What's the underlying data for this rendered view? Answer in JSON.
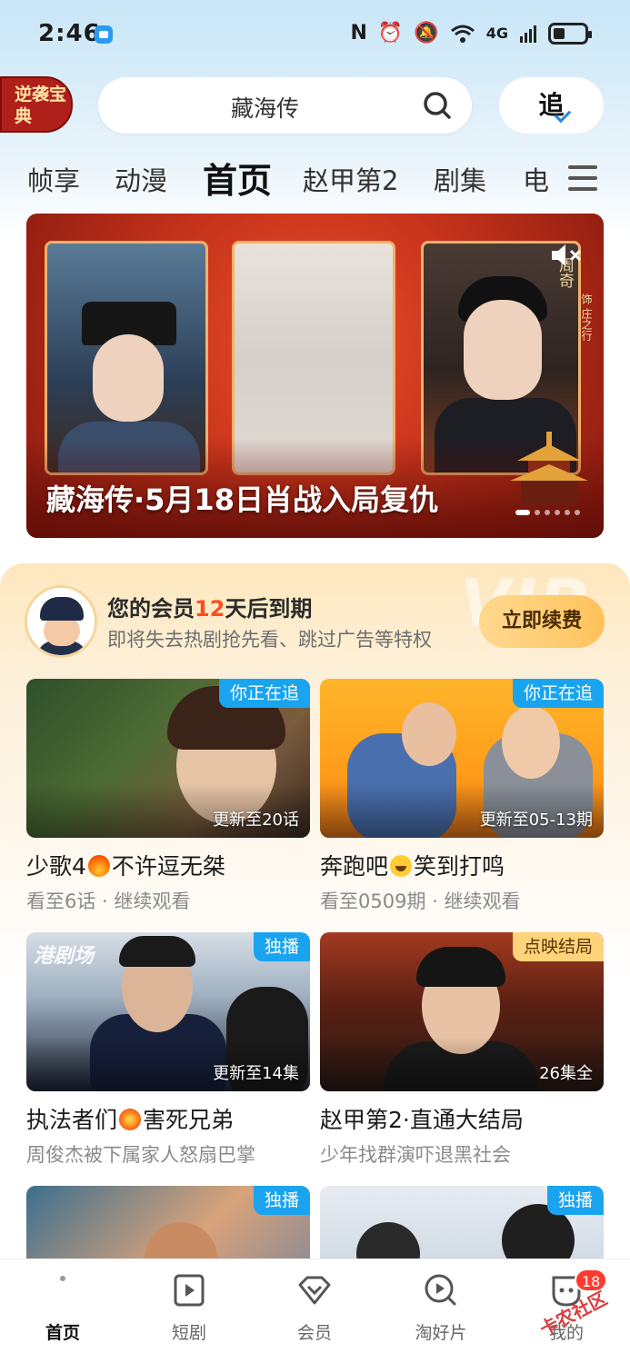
{
  "status_bar": {
    "time": "2:46",
    "network": "4G"
  },
  "header": {
    "promo_badge": "逆袭宝典",
    "search_text": "藏海传",
    "follow_label": "追"
  },
  "tabs": [
    {
      "label": "帧享",
      "active": false
    },
    {
      "label": "动漫",
      "active": false
    },
    {
      "label": "首页",
      "active": true
    },
    {
      "label": "赵甲第2",
      "active": false
    },
    {
      "label": "剧集",
      "active": false
    },
    {
      "label": "电",
      "active": false
    }
  ],
  "banner": {
    "title": "藏海传·5月18日肖战入局复仇",
    "cast_name": "周奇",
    "cast_role": "饰 庄之行",
    "page_count": 6,
    "current_page": 1
  },
  "member": {
    "title_prefix": "您的会员",
    "days": "12",
    "title_suffix": "天后到期",
    "subtitle": "即将失去热剧抢先看、跳过广告等特权",
    "renew_label": "立即续费",
    "watermark": "VIP"
  },
  "cards": [
    {
      "tag": "你正在追",
      "tag_style": "blue",
      "info": "更新至20话",
      "title_a": "少歌4",
      "emoji": "fire",
      "title_b": "不许逗无桀",
      "subtitle": "看至6话 · 继续观看"
    },
    {
      "tag": "你正在追",
      "tag_style": "blue",
      "info": "更新至05-13期",
      "title_a": "奔跑吧",
      "emoji": "laugh",
      "title_b": "笑到打鸣",
      "subtitle": "看至0509期 · 继续观看"
    },
    {
      "tag": "独播",
      "tag_style": "blue",
      "info": "更新至14集",
      "logo": "港剧场",
      "title_a": "执法者们",
      "emoji": "boom",
      "title_b": "害死兄弟",
      "subtitle": "周俊杰被下属家人怒扇巴掌"
    },
    {
      "tag": "点映结局",
      "tag_style": "gold",
      "info": "26集全",
      "title_a": "赵甲第2·直通大结局",
      "subtitle": "少年找群演吓退黑社会"
    },
    {
      "tag": "独播",
      "tag_style": "blue"
    },
    {
      "tag": "独播",
      "tag_style": "blue"
    }
  ],
  "bottom_nav": [
    {
      "label": "首页",
      "icon": "home-icon",
      "active": true
    },
    {
      "label": "短剧",
      "icon": "short-drama-icon",
      "active": false
    },
    {
      "label": "会员",
      "icon": "vip-diamond-icon",
      "active": false
    },
    {
      "label": "淘好片",
      "icon": "discover-icon",
      "active": false
    },
    {
      "label": "我的",
      "icon": "profile-icon",
      "active": false,
      "badge": "18"
    }
  ],
  "watermark": "卡农社区",
  "colors": {
    "accent_blue": "#1aa4f0",
    "days_red": "#ff4d1f",
    "renew_gold": "#ffc25a",
    "badge_red": "#ff3b30"
  }
}
